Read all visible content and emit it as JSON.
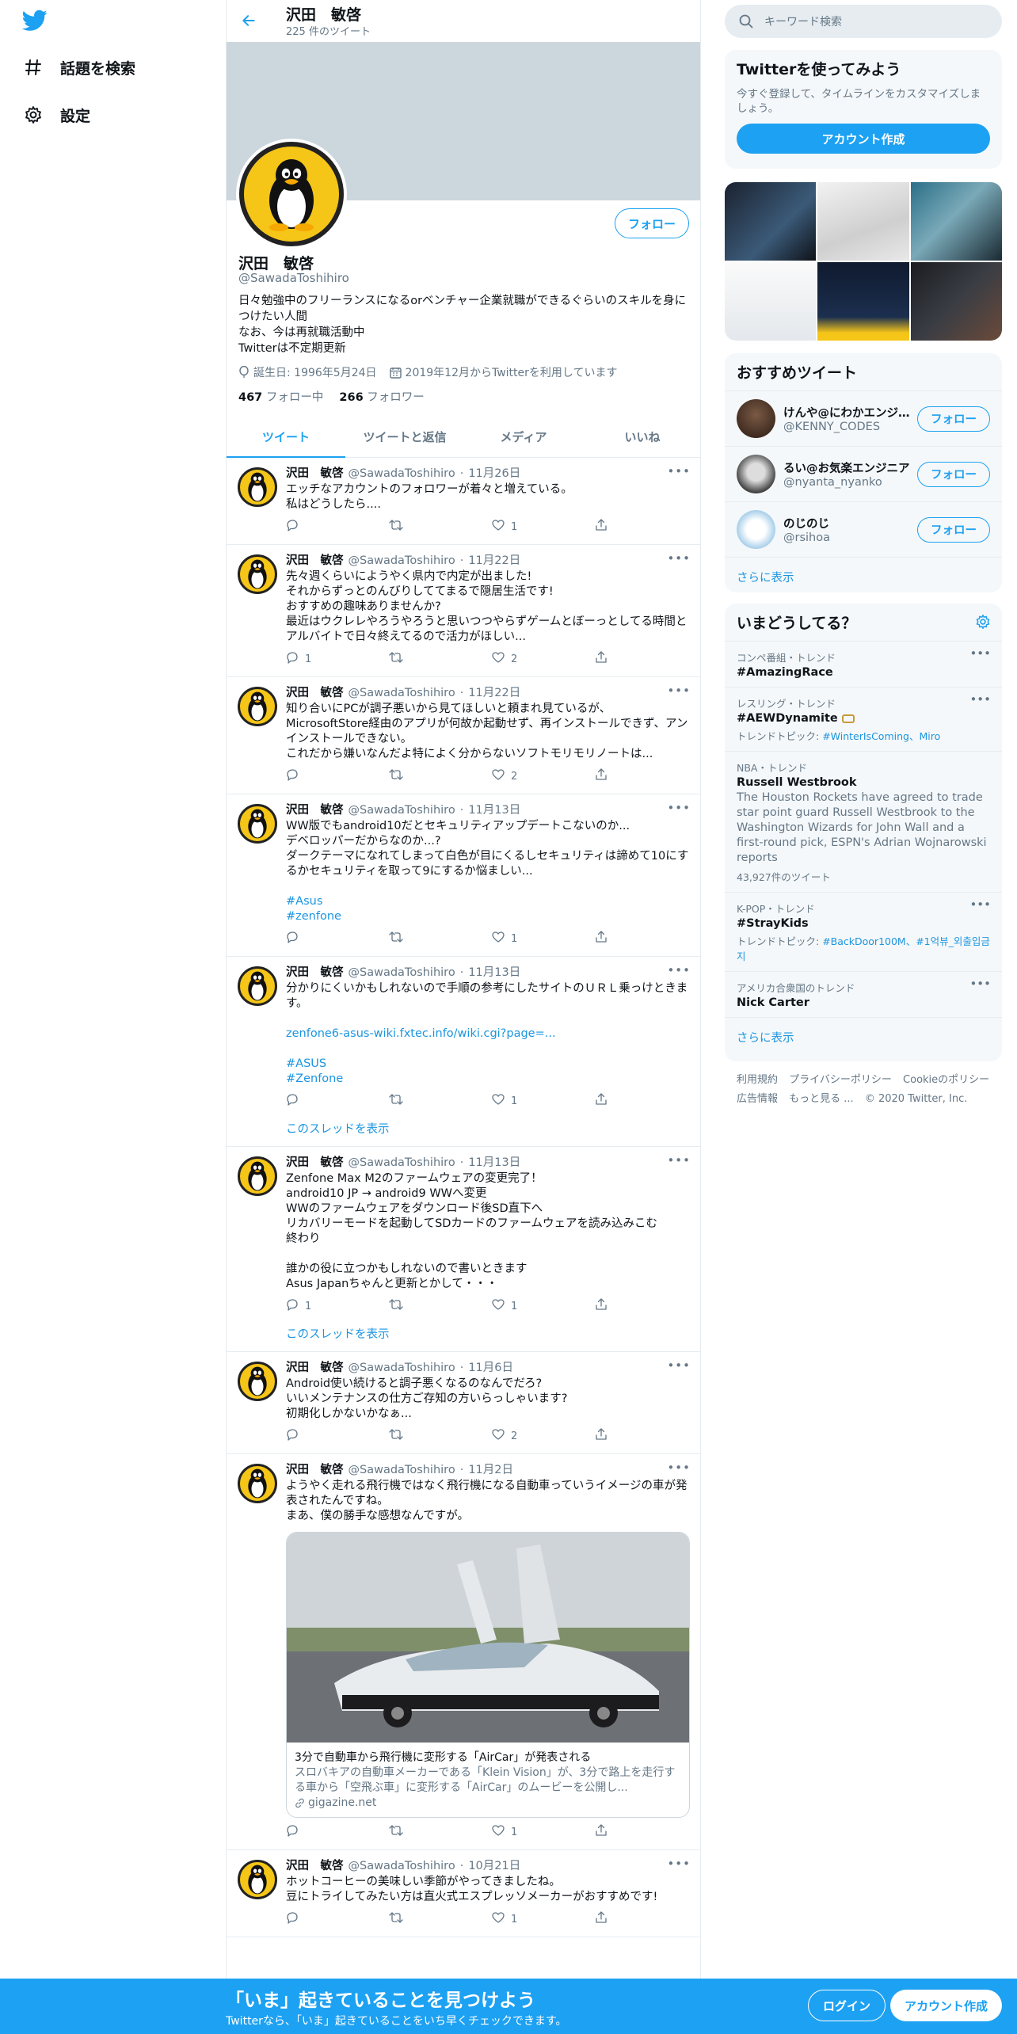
{
  "nav": {
    "items": [
      {
        "label": "話題を検索",
        "icon": "hashtag-icon"
      },
      {
        "label": "設定",
        "icon": "gear-icon"
      }
    ]
  },
  "header": {
    "name": "沢田　敏啓",
    "tweet_count": "225 件のツイート"
  },
  "profile": {
    "name": "沢田　敏啓",
    "handle": "@SawadaToshihiro",
    "follow_label": "フォロー",
    "bio": "日々勉強中のフリーランスになるorベンチャー企業就職ができるぐらいのスキルを身につけたい人間\nなお、今は再就職活動中\nTwitterは不定期更新",
    "birthday": "誕生日: 1996年5月24日",
    "joined": "2019年12月からTwitterを利用しています",
    "following_count": "467",
    "following_label": "フォロー中",
    "followers_count": "266",
    "followers_label": "フォロワー"
  },
  "tabs": [
    "ツイート",
    "ツイートと返信",
    "メディア",
    "いいね"
  ],
  "tweets": [
    {
      "name": "沢田　敏啓",
      "handle": "@SawadaToshihiro",
      "date": "11月26日",
      "text": "エッチなアカウントのフォロワーが着々と増えている。\n私はどうしたら....",
      "replies": "",
      "retweets": "",
      "likes": "1"
    },
    {
      "name": "沢田　敏啓",
      "handle": "@SawadaToshihiro",
      "date": "11月22日",
      "text": "先々週くらいにようやく県内で内定が出ました!\nそれからずっとのんびりしててまるで隠居生活です!\nおすすめの趣味ありませんか?\n最近はウクレレやろうやろうと思いつつやらずゲームとぼーっとしてる時間とアルバイトで日々終えてるので活力がほしい...",
      "replies": "1",
      "retweets": "",
      "likes": "2"
    },
    {
      "name": "沢田　敏啓",
      "handle": "@SawadaToshihiro",
      "date": "11月22日",
      "text": "知り合いにPCが調子悪いから見てほしいと頼まれ見ているが、MicrosoftStore経由のアプリが何故か起動せず、再インストールできず、アンインストールできない。\nこれだから嫌いなんだよ特によく分からないソフトモリモリノートは...",
      "replies": "",
      "retweets": "",
      "likes": "2"
    },
    {
      "name": "沢田　敏啓",
      "handle": "@SawadaToshihiro",
      "date": "11月13日",
      "text": "WW版でもandroid10だとセキュリティアップデートこないのか...\nデベロッパーだからなのか...?\nダークテーマになれてしまって白色が目にくるしセキュリティは諦めて10にするかセキュリティを取って9にするか悩ましい...",
      "tags": "#Asus\n#zenfone",
      "replies": "",
      "retweets": "",
      "likes": "1"
    },
    {
      "name": "沢田　敏啓",
      "handle": "@SawadaToshihiro",
      "date": "11月13日",
      "text": "分かりにくいかもしれないので手順の参考にしたサイトのＵＲＬ乗っけときます。",
      "link": "zenfone6-asus-wiki.fxtec.info/wiki.cgi?page=...",
      "tags": "#ASUS\n#Zenfone",
      "replies": "",
      "retweets": "",
      "likes": "1",
      "thread": "このスレッドを表示"
    },
    {
      "name": "沢田　敏啓",
      "handle": "@SawadaToshihiro",
      "date": "11月13日",
      "text": "Zenfone Max M2のファームウェアの変更完了！\nandroid10 JP → android9 WWへ変更\nWWのファームウェアをダウンロード後SD直下へ\nリカバリーモードを起動してSDカードのファームウェアを読み込みこむ\n終わり\n\n誰かの役に立つかもしれないので書いときます\nAsus Japanちゃんと更新とかして・・・",
      "replies": "1",
      "retweets": "",
      "likes": "1",
      "thread": "このスレッドを表示"
    },
    {
      "name": "沢田　敏啓",
      "handle": "@SawadaToshihiro",
      "date": "11月6日",
      "text": "Android使い続けると調子悪くなるのなんでだろ?\nいいメンテナンスの仕方ご存知の方いらっしゃいます?\n初期化しかないかなぁ...",
      "replies": "",
      "retweets": "",
      "likes": "2"
    },
    {
      "name": "沢田　敏啓",
      "handle": "@SawadaToshihiro",
      "date": "11月2日",
      "text": "ようやく走れる飛行機ではなく飛行機になる自動車っていうイメージの車が発表されたんですね。\nまあ、僕の勝手な感想なんですが。",
      "card": {
        "title": "3分で自動車から飛行機に変形する「AirCar」が発表される",
        "desc": "スロバキアの自動車メーカーである「Klein Vision」が、3分で路上を走行する車から「空飛ぶ車」に変形する「AirCar」のムービーを公開し...",
        "url": "gigazine.net"
      },
      "replies": "",
      "retweets": "",
      "likes": "1"
    },
    {
      "name": "沢田　敏啓",
      "handle": "@SawadaToshihiro",
      "date": "10月21日",
      "text": "ホットコーヒーの美味しい季節がやってきましたね。\n豆にトライしてみたい方は直火式エスプレッソメーカーがおすすめです!",
      "replies": "",
      "retweets": "",
      "likes": "1"
    }
  ],
  "search": {
    "placeholder": "キーワード検索"
  },
  "signup_box": {
    "title": "Twitterを使ってみよう",
    "subtitle": "今すぐ登録して、タイムラインをカスタマイズしましょう。",
    "button": "アカウント作成"
  },
  "recommend": {
    "title": "おすすめツイート",
    "users": [
      {
        "name": "けんや@にわかエンジニア",
        "handle": "@KENNY_CODES",
        "button": "フォロー"
      },
      {
        "name": "るい@お気楽エンジニア",
        "handle": "@nyanta_nyanko",
        "button": "フォロー"
      },
      {
        "name": "のじのじ",
        "handle": "@rsihoa",
        "button": "フォロー"
      }
    ],
    "more": "さらに表示"
  },
  "trends": {
    "title": "いまどうしてる？",
    "items": [
      {
        "context": "コンペ番組・トレンド",
        "name": "#AmazingRace"
      },
      {
        "context": "レスリング・トレンド",
        "name": "#AEWDynamite",
        "sub_prefix": "トレンドトピック: ",
        "sub_links": "#WinterIsComing、Miro"
      },
      {
        "context": "NBA・トレンド",
        "name": "Russell Westbrook",
        "desc": "The Houston Rockets have agreed to trade star point guard Russell Westbrook to the Washington Wizards for John Wall and a first-round pick, ESPN's Adrian Wojnarowski reports",
        "count": "43,927件のツイート"
      },
      {
        "context": "K-POP・トレンド",
        "name": "#StrayKids",
        "sub_prefix": "トレンドトピック: ",
        "sub_links": "#BackDoor100M、#1억뷰_외출입금지"
      },
      {
        "context": "アメリカ合衆国のトレンド",
        "name": "Nick Carter"
      }
    ],
    "more": "さらに表示"
  },
  "footer": {
    "links": [
      "利用規約",
      "プライバシーポリシー",
      "Cookieのポリシー",
      "広告情報",
      "もっと見る ...",
      "© 2020 Twitter, Inc."
    ]
  },
  "bottom_bar": {
    "title": "「いま」起きていることを見つけよう",
    "subtitle": "Twitterなら、「いま」起きていることをいち早くチェックできます。",
    "login": "ログイン",
    "signup": "アカウント作成"
  },
  "colors": {
    "accent": "#1da1f2",
    "text": "#0f1419",
    "muted": "#657786",
    "bg_box": "#f5f8fa"
  }
}
